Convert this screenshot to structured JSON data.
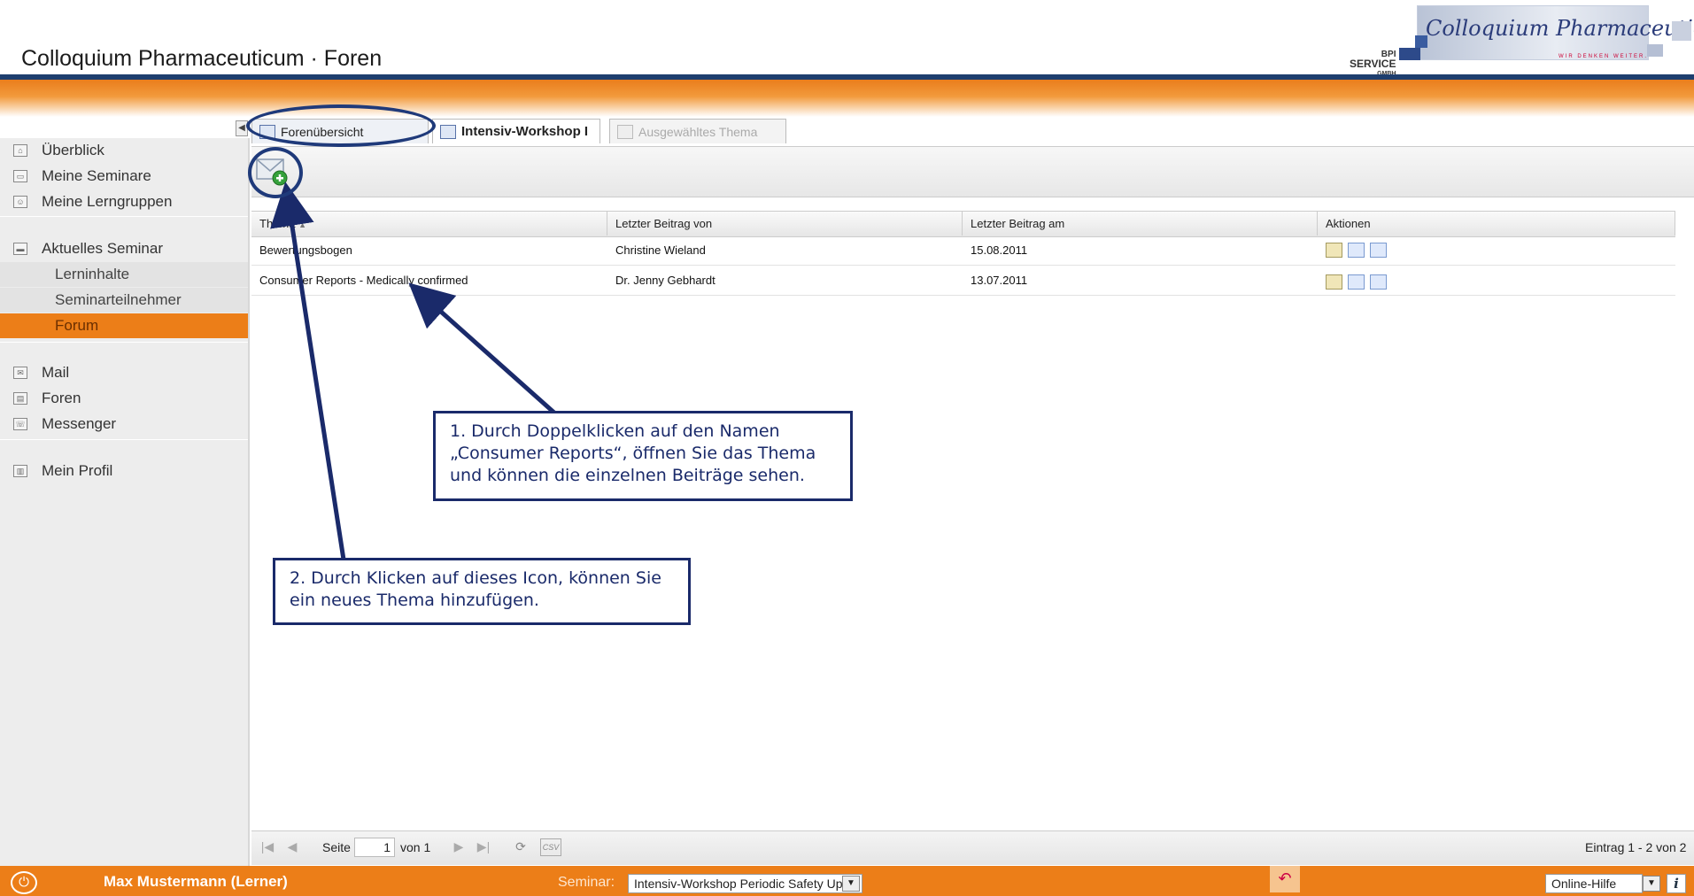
{
  "app": {
    "title": "Colloquium Pharmaceuticum · Foren"
  },
  "logo": {
    "service_line1": "BPI",
    "service_line2": "SERVICE",
    "service_line3": "GMBH",
    "brand": "Colloquium Pharmaceuticum",
    "slogan": "WIR DENKEN WEITER."
  },
  "sidebar": {
    "items": [
      {
        "label": "Überblick",
        "icon": "home-icon"
      },
      {
        "label": "Meine Seminare",
        "icon": "seminar-icon"
      },
      {
        "label": "Meine Lerngruppen",
        "icon": "group-icon"
      },
      {
        "label": "Aktuelles Seminar",
        "icon": "monitor-icon"
      },
      {
        "label": "Lerninhalte"
      },
      {
        "label": "Seminarteilnehmer"
      },
      {
        "label": "Forum"
      },
      {
        "label": "Mail",
        "icon": "mail-icon"
      },
      {
        "label": "Foren",
        "icon": "forum-icon"
      },
      {
        "label": "Messenger",
        "icon": "messenger-icon"
      },
      {
        "label": "Mein Profil",
        "icon": "profile-icon"
      }
    ],
    "active": "Forum"
  },
  "tabs": [
    {
      "label": "Forenübersicht",
      "state": "normal"
    },
    {
      "label": "Intensiv-Workshop I",
      "state": "active"
    },
    {
      "label": "Ausgewähltes Thema",
      "state": "disabled"
    }
  ],
  "grid": {
    "columns": [
      "Thema",
      "Letzter Beitrag von",
      "Letzter Beitrag am",
      "Aktionen"
    ],
    "rows": [
      {
        "thema": "Bewertungsbogen",
        "von": "Christine Wieland",
        "am": "15.08.2011"
      },
      {
        "thema": "Consumer Reports - Medically confirmed",
        "von": "Dr. Jenny Gebhardt",
        "am": "13.07.2011"
      }
    ]
  },
  "paging": {
    "page_label": "Seite",
    "page_value": "1",
    "of_label": "von 1",
    "summary": "Eintrag 1 - 2 von 2",
    "export_label": "CSV"
  },
  "footer": {
    "user": "Max Mustermann (Lerner)",
    "seminar_label": "Seminar:",
    "seminar_value": "Intensiv-Workshop Periodic Safety Up",
    "help_value": "Online-Hilfe",
    "info_label": "i"
  },
  "callouts": {
    "one": "1. Durch Doppelklicken auf den Namen „Consumer Reports“, öffnen Sie das Thema und können die einzelnen Beiträge sehen.",
    "two": "2. Durch Klicken auf dieses Icon, können Sie ein neues Thema hinzufügen."
  },
  "colors": {
    "accent": "#ec7e18",
    "navy": "#1e3e6e",
    "callout": "#1a2a6a"
  }
}
